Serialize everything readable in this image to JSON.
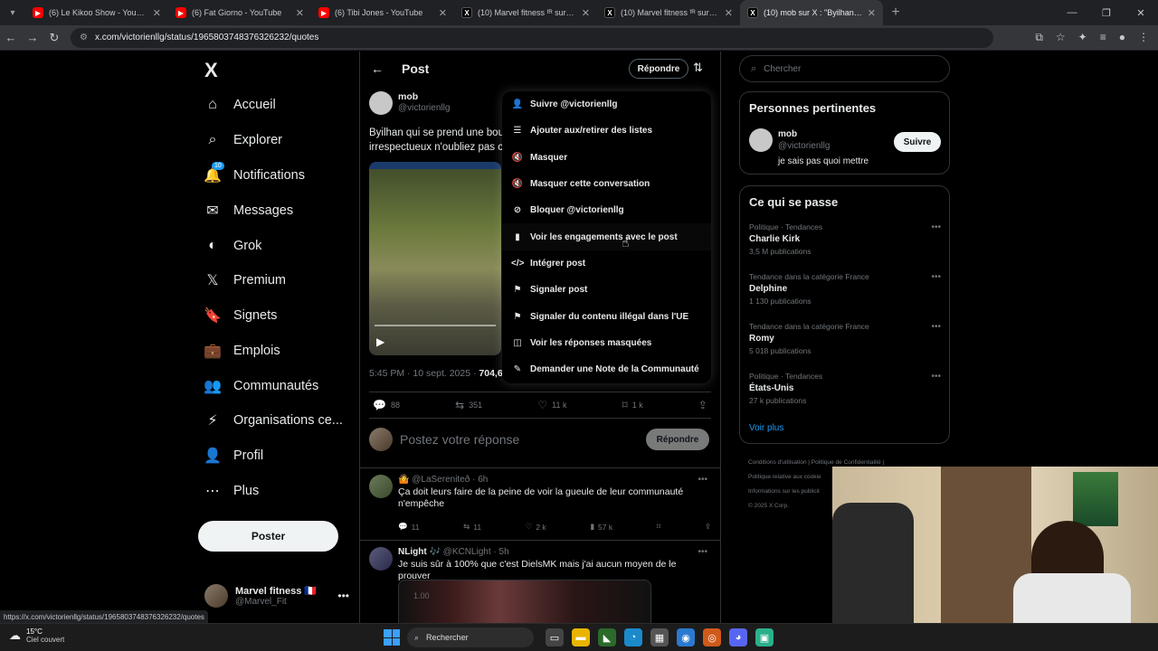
{
  "browser": {
    "tabs": [
      {
        "title": "(6) Le Kikoo Show - YouTube",
        "type": "yt"
      },
      {
        "title": "(6) Fat Giorno - YouTube",
        "type": "yt"
      },
      {
        "title": "(6) Tibi Jones - YouTube",
        "type": "yt"
      },
      {
        "title": "(10) Marvel fitness ᶠᴿ sur X : \"",
        "type": "x"
      },
      {
        "title": "(10) Marvel fitness ᶠᴿ sur X : \"er",
        "type": "x"
      },
      {
        "title": "(10) mob sur X : \"Byilhan qui se",
        "type": "x"
      }
    ],
    "url": "x.com/victorienllg/status/1965803748376326232/quotes",
    "status_link": "https://x.com/victorienllg/status/1965803748376326232/quotes"
  },
  "nav": {
    "logo": "X",
    "items": [
      {
        "label": "Accueil",
        "icon": "⌂"
      },
      {
        "label": "Explorer",
        "icon": "⌕"
      },
      {
        "label": "Notifications",
        "icon": "🔔"
      },
      {
        "label": "Messages",
        "icon": "✉"
      },
      {
        "label": "Grok",
        "icon": "◐"
      },
      {
        "label": "Premium",
        "icon": "𝕏"
      },
      {
        "label": "Signets",
        "icon": "🔖"
      },
      {
        "label": "Emplois",
        "icon": "💼"
      },
      {
        "label": "Communautés",
        "icon": "👥"
      },
      {
        "label": "Organisations ce...",
        "icon": "⚡"
      },
      {
        "label": "Profil",
        "icon": "👤"
      },
      {
        "label": "Plus",
        "icon": "⋯"
      }
    ],
    "notif_badge": "10",
    "post_button": "Poster",
    "account": {
      "name": "Marvel fitness 🇫🇷",
      "handle": "@Marvel_Fit"
    }
  },
  "header": {
    "title": "Post",
    "reply_label": "Répondre"
  },
  "post": {
    "author": "mob",
    "handle": "@victorienllg",
    "text_line1": "Byilhan qui se prend une bou",
    "text_line2": "irrespectueux n'oubliez pas c",
    "meta_time": "5:45 PM · 10 sept. 2025 · ",
    "meta_views": "704,6 k",
    "stats": {
      "replies": "88",
      "reposts": "351",
      "likes": "11 k",
      "bookmarks": "1 k"
    }
  },
  "reply_box": {
    "placeholder": "Postez votre réponse",
    "button": "Répondre"
  },
  "replies": [
    {
      "name": "",
      "handle": "@LaSereniteð",
      "time": "· 6h",
      "text": "Ça doit leurs faire de la peine de voir la gueule de leur communauté n'empêche",
      "stats": {
        "replies": "11",
        "reposts": "11",
        "likes": "2 k",
        "views": "57 k"
      }
    },
    {
      "name": "NLight",
      "handle": "@KCNLight",
      "time": "· 5h",
      "text": "Je suis sûr à 100% que c'est DielsMK mais j'ai aucun moyen de le prouver",
      "image_label": "1.00"
    }
  ],
  "menu": [
    {
      "label": "Suivre @victorienllg",
      "icon": "👤"
    },
    {
      "label": "Ajouter aux/retirer des listes",
      "icon": "☰"
    },
    {
      "label": "Masquer",
      "icon": "🔇"
    },
    {
      "label": "Masquer cette conversation",
      "icon": "🔇"
    },
    {
      "label": "Bloquer @victorienllg",
      "icon": "⊘"
    },
    {
      "label": "Voir les engagements avec le post",
      "icon": "▮"
    },
    {
      "label": "Intégrer post",
      "icon": "</>"
    },
    {
      "label": "Signaler post",
      "icon": "⚑"
    },
    {
      "label": "Signaler du contenu illégal dans l'UE",
      "icon": "⚑"
    },
    {
      "label": "Voir les réponses masquées",
      "icon": "◫"
    },
    {
      "label": "Demander une Note de la Communauté",
      "icon": "✎"
    }
  ],
  "sidebar": {
    "search_placeholder": "Chercher",
    "relevant_title": "Personnes pertinentes",
    "relevant_person": {
      "name": "mob",
      "handle": "@victorienllg",
      "bio": "je sais pas quoi mettre",
      "follow": "Suivre"
    },
    "trends_title": "Ce qui se passe",
    "trends": [
      {
        "category": "Politique · Tendances",
        "name": "Charlie Kirk",
        "count": "3,5 M publications"
      },
      {
        "category": "Tendance dans la catégorie France",
        "name": "Delphine",
        "count": "1 130 publications"
      },
      {
        "category": "Tendance dans la catégorie France",
        "name": "Romy",
        "count": "5 018 publications"
      },
      {
        "category": "Politique · Tendances",
        "name": "États-Unis",
        "count": "27 k publications"
      }
    ],
    "see_more": "Voir plus",
    "footer": {
      "line1a": "Conditions d'utilisation",
      "line1b": "Politique de Confidentialité",
      "line2": "Politique relative aux cookie",
      "line3": "Informations sur les publicit",
      "line4": "© 2025 X Corp."
    }
  },
  "taskbar": {
    "weather_temp": "15°C",
    "weather_desc": "Ciel couvert",
    "search_label": "Rechercher"
  }
}
